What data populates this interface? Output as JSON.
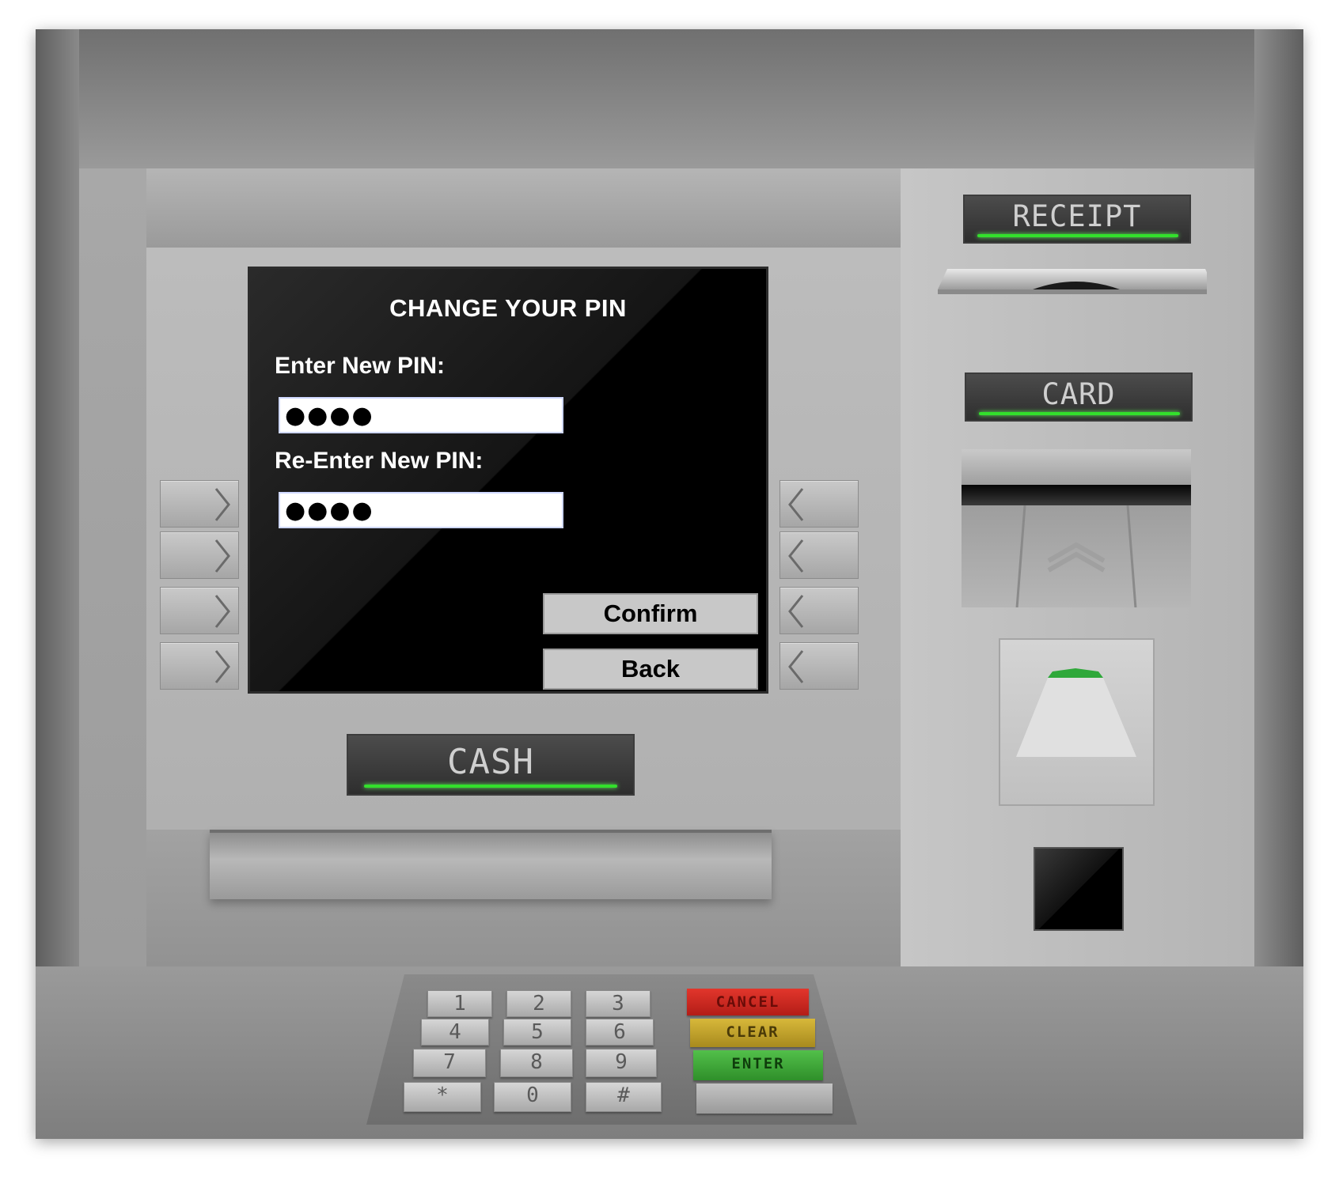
{
  "screen": {
    "title": "CHANGE YOUR PIN",
    "new_pin": {
      "label": "Enter New PIN:",
      "value": "●●●●"
    },
    "reenter_pin": {
      "label": "Re-Enter New PIN:",
      "value": "●●●●"
    },
    "confirm_label": "Confirm",
    "back_label": "Back"
  },
  "plates": {
    "cash": "CASH",
    "receipt": "RECEIPT",
    "card": "CARD"
  },
  "keypad": {
    "digits": [
      "1",
      "2",
      "3",
      "4",
      "5",
      "6",
      "7",
      "8",
      "9",
      "*",
      "0",
      "#"
    ],
    "cancel": "CANCEL",
    "clear": "CLEAR",
    "enter": "ENTER"
  },
  "colors": {
    "led_green": "#33e02c",
    "cancel_red": "#d42a22",
    "clear_yellow": "#c9a82a",
    "enter_green": "#3fae3a"
  }
}
